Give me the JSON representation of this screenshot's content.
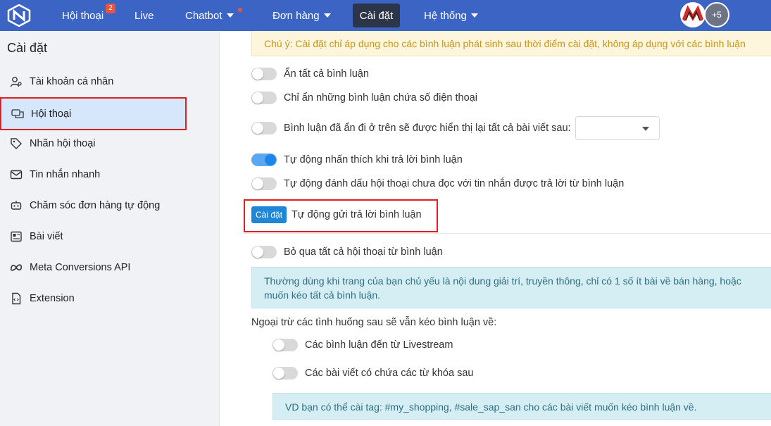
{
  "topnav": {
    "items": [
      {
        "label": "Hội thoại",
        "badge": "2"
      },
      {
        "label": "Live"
      },
      {
        "label": "Chatbot"
      },
      {
        "label": "Đơn hàng"
      },
      {
        "label": "Cài đặt"
      },
      {
        "label": "Hệ thống"
      }
    ],
    "more_avatars": "+5",
    "accent": "#3b64c4"
  },
  "sidebar": {
    "title": "Cài đặt",
    "items": [
      {
        "label": "Tài khoản cá nhân",
        "icon": "user-gear-icon"
      },
      {
        "label": "Hội thoại",
        "icon": "chat-bubbles-icon"
      },
      {
        "label": "Nhãn hội thoại",
        "icon": "tag-icon"
      },
      {
        "label": "Tin nhắn nhanh",
        "icon": "envelope-icon"
      },
      {
        "label": "Chăm sóc đơn hàng tự động",
        "icon": "bot-icon"
      },
      {
        "label": "Bài viết",
        "icon": "newspaper-icon"
      },
      {
        "label": "Meta Conversions API",
        "icon": "meta-icon"
      },
      {
        "label": "Extension",
        "icon": "file-code-icon"
      }
    ]
  },
  "main": {
    "note_top": "Chú ý: Cài đặt chỉ áp dụng cho các bình luận phát sinh sau thời điểm cài đặt, không áp dụng với các bình luận",
    "toggles": [
      {
        "label": "Ẩn tất cả bình luận",
        "on": false
      },
      {
        "label": "Chỉ ẩn những bình luận chứa số điện thoại",
        "on": false
      },
      {
        "label": "Bình luận đã ẩn đi ở trên sẽ được hiển thị lại tất cả bài viết sau:",
        "on": false
      },
      {
        "label": "Tự động nhấn thích khi trả lời bình luận",
        "on": true
      },
      {
        "label": "Tự động đánh dấu hội thoại chưa đọc với tin nhắn được trả lời từ bình luận",
        "on": false
      }
    ],
    "setup_button": "Cài đặt",
    "setup_label": "Tự động gửi trả lời bình luận",
    "skip_toggle": {
      "label": "Bỏ qua tất cả hội thoại từ bình luận",
      "on": false
    },
    "note_info": "Thường dùng khi trang của bạn chủ yếu là nội dung giải trí, truyền thông, chỉ có 1 số ít bài về bán hàng, hoặc",
    "note_info_2": "muốn kéo tất cả bình luận.",
    "except_title": "Ngoại trừ các tình huống sau sẽ vẫn kéo bình luận về:",
    "sub_toggles": [
      {
        "label": "Các bình luận đến từ Livestream",
        "on": false
      },
      {
        "label": "Các bài viết có chứa các từ khóa sau",
        "on": false
      }
    ],
    "note_tag": "VD bạn có thể cài tag: #my_shopping, #sale_sap_san cho các bài viết muốn kéo bình luận về."
  }
}
